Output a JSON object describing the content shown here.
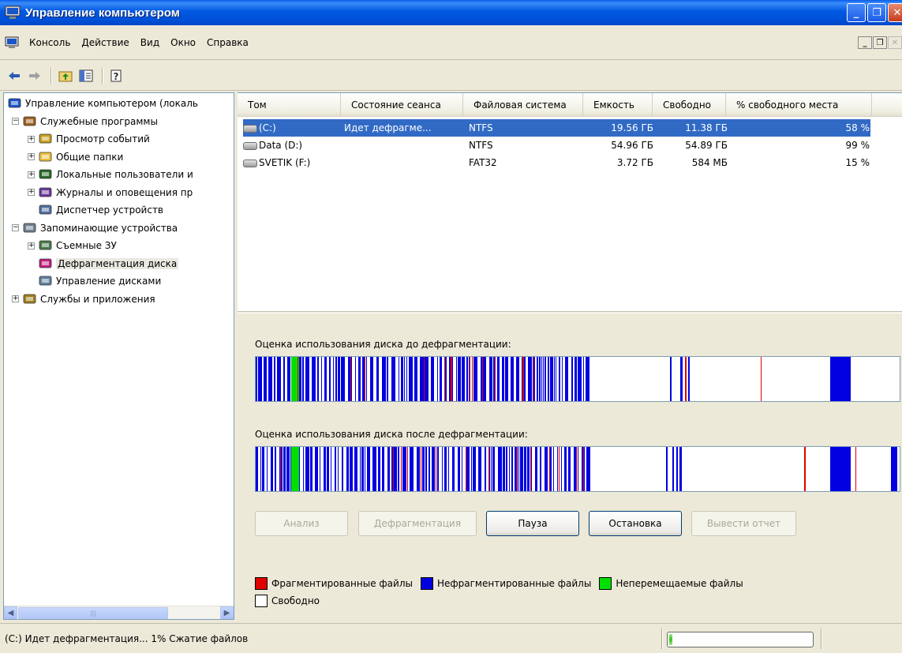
{
  "window": {
    "title": "Управление компьютером"
  },
  "menu": {
    "items": [
      "Консоль",
      "Действие",
      "Вид",
      "Окно",
      "Справка"
    ]
  },
  "toolbar": {
    "back_icon": "back-arrow-icon",
    "forward_icon": "forward-arrow-icon",
    "up_icon": "up-folder-icon",
    "console_tree_icon": "console-tree-icon",
    "help_icon": "help-icon"
  },
  "tree": {
    "items": [
      {
        "label": "Управление компьютером (локаль",
        "level": 0,
        "expander": "",
        "icon": "computer-icon"
      },
      {
        "label": "Служебные программы",
        "level": 1,
        "expander": "−",
        "icon": "tools-icon"
      },
      {
        "label": "Просмотр событий",
        "level": 2,
        "expander": "+",
        "icon": "event-viewer-icon"
      },
      {
        "label": "Общие папки",
        "level": 2,
        "expander": "+",
        "icon": "shared-folder-icon"
      },
      {
        "label": "Локальные пользователи и",
        "level": 2,
        "expander": "+",
        "icon": "users-icon"
      },
      {
        "label": "Журналы и оповещения пр",
        "level": 2,
        "expander": "+",
        "icon": "logs-icon"
      },
      {
        "label": "Диспетчер устройств",
        "level": 2,
        "expander": "",
        "icon": "device-manager-icon"
      },
      {
        "label": "Запоминающие устройства",
        "level": 1,
        "expander": "−",
        "icon": "storage-icon"
      },
      {
        "label": "Съемные ЗУ",
        "level": 2,
        "expander": "+",
        "icon": "removable-storage-icon"
      },
      {
        "label": "Дефрагментация диска",
        "level": 2,
        "expander": "",
        "icon": "defrag-icon",
        "selected": true
      },
      {
        "label": "Управление дисками",
        "level": 2,
        "expander": "",
        "icon": "disk-management-icon"
      },
      {
        "label": "Службы и приложения",
        "level": 1,
        "expander": "+",
        "icon": "services-icon"
      }
    ]
  },
  "volumes": {
    "columns": [
      "Том",
      "Состояние сеанса",
      "Файловая система",
      "Емкость",
      "Свободно",
      "% свободного места"
    ],
    "rows": [
      {
        "name": "(C:)",
        "state": "Идет дефрагме...",
        "fs": "NTFS",
        "capacity": "19.56 ГБ",
        "free": "11.38 ГБ",
        "pct": "58 %",
        "selected": true
      },
      {
        "name": "Data (D:)",
        "state": "",
        "fs": "NTFS",
        "capacity": "54.96 ГБ",
        "free": "54.89 ГБ",
        "pct": "99 %"
      },
      {
        "name": "SVETIK (F:)",
        "state": "",
        "fs": "FAT32",
        "capacity": "3.72 ГБ",
        "free": "584 МБ",
        "pct": "15 %"
      }
    ]
  },
  "defrag": {
    "before_label": "Оценка использования диска до дефрагментации:",
    "after_label": "Оценка использования диска после дефрагментации:",
    "buttons": {
      "analyze": "Анализ",
      "defragment": "Дефрагментация",
      "pause": "Пауза",
      "stop": "Остановка",
      "report": "Вывести отчет"
    },
    "legend": {
      "fragmented": "Фрагментированные файлы",
      "contiguous": "Нефрагментированные файлы",
      "unmovable": "Неперемещаемые файлы",
      "free": "Свободно"
    },
    "colors": {
      "fragmented": "#e00000",
      "contiguous": "#0000e0",
      "unmovable": "#00e000",
      "free": "#ffffff"
    }
  },
  "status": {
    "text": "(C:) Идет дефрагментация... 1% Сжатие файлов",
    "progress_percent": 2
  }
}
